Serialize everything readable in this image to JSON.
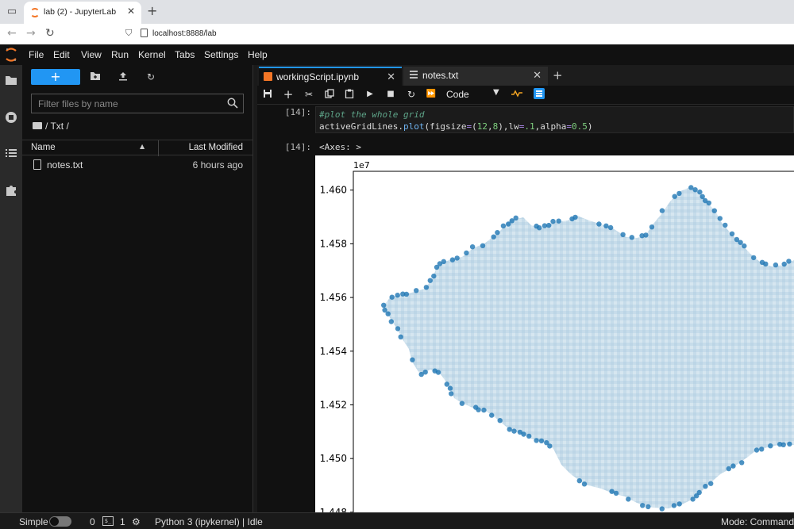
{
  "browser": {
    "tab_title": "lab (2) - JupyterLab",
    "url": "localhost:8888/lab"
  },
  "menu": [
    "File",
    "Edit",
    "View",
    "Run",
    "Kernel",
    "Tabs",
    "Settings",
    "Help"
  ],
  "filebrowser": {
    "new_label": "+",
    "filter_placeholder": "Filter files by name",
    "breadcrumb": "/ Txt /",
    "col_name": "Name",
    "col_modified": "Last Modified",
    "files": [
      {
        "name": "notes.txt",
        "modified": "6 hours ago"
      }
    ]
  },
  "tabs": [
    {
      "label": "workingScript.ipynb",
      "icon": "notebook-icon"
    },
    {
      "label": "notes.txt",
      "icon": "text-file-icon"
    }
  ],
  "toolbar": {
    "cell_type": "Code"
  },
  "cell": {
    "in_prompt": "[14]:",
    "code_comment": "#plot the whole grid",
    "code_line": {
      "obj": "activeGridLines.",
      "func": "plot",
      "p1": "(figsize",
      "eq1": "=",
      "p2": "(",
      "n1": "12",
      "p3": ",",
      "n2": "8",
      "p4": "),lw",
      "eq2": "=",
      "n3": ".1",
      "p5": ",alpha",
      "eq3": "=",
      "n4": "0.5",
      "p6": ")"
    },
    "out_prompt": "[14]:",
    "out_text": "<Axes: >"
  },
  "chart_data": {
    "type": "scatter",
    "offset_label": "1e7",
    "yticks": [
      "1.460",
      "1.458",
      "1.456",
      "1.454",
      "1.452",
      "1.450",
      "1.448"
    ],
    "yvalues": [
      1.46,
      1.458,
      1.456,
      1.454,
      1.452,
      1.45,
      1.448
    ],
    "ylim": [
      1.4477,
      1.4607
    ],
    "colors": {
      "fill": "#c6dcea",
      "edge": "#1f77b4"
    }
  },
  "status": {
    "mode_label": "Simple",
    "count0": "0",
    "count1": "1",
    "kernel": "Python 3 (ipykernel) | Idle",
    "mode": "Mode: Command"
  }
}
